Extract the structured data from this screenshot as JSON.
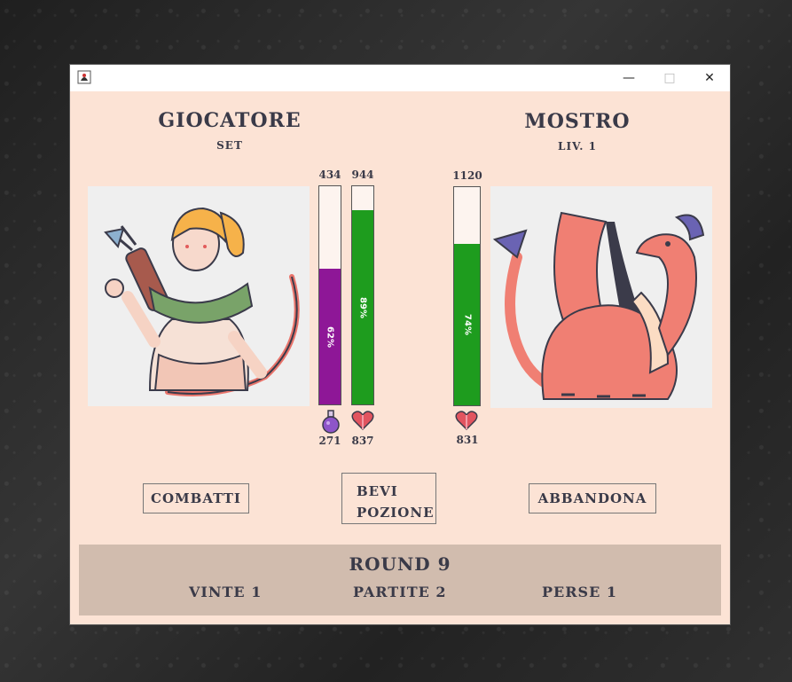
{
  "window": {
    "title": ""
  },
  "player": {
    "heading": "GIOCATORE",
    "name": "SET",
    "mana": {
      "max": "434",
      "current": "271",
      "percent_label": "62%",
      "fraction": 0.62,
      "color": "#8e1797"
    },
    "health": {
      "max": "944",
      "current": "837",
      "percent_label": "89%",
      "fraction": 0.89,
      "color": "#1e9c1e"
    }
  },
  "monster": {
    "heading": "MOSTRO",
    "level": "LIV. 1",
    "health": {
      "max": "1120",
      "current": "831",
      "percent_label": "74%",
      "fraction": 0.74,
      "color": "#1e9c1e"
    }
  },
  "actions": {
    "fight": "COMBATTI",
    "potion_line1": "BEVI",
    "potion_line2": "POZIONE",
    "abandon": "ABBANDONA"
  },
  "footer": {
    "round": "ROUND 9",
    "wins": "VINTE 1",
    "matches": "PARTITE 2",
    "losses": "PERSE 1"
  },
  "icons": {
    "potion": "potion-icon",
    "heart": "heart-icon",
    "archer": "archer-portrait",
    "dragon": "dragon-portrait"
  }
}
